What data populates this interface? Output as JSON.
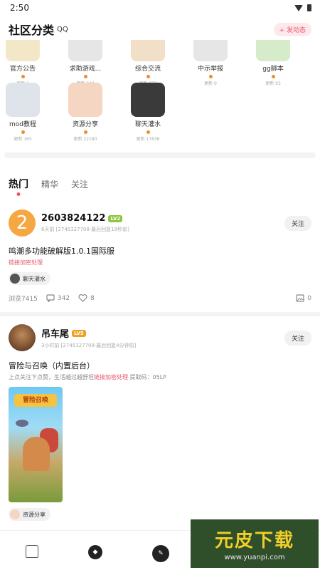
{
  "status_bar": {
    "time": "2:50"
  },
  "header": {
    "title": "社区分类",
    "title_icon": "QQ",
    "new_button": "+ 发动态"
  },
  "categories": [
    {
      "name": "官方公告",
      "count": "更新 6",
      "color": "#f2e8c8"
    },
    {
      "name": "求助游戏...",
      "count": "更新 240",
      "color": "#e6e6e6"
    },
    {
      "name": "综合交流",
      "count": "更新 872",
      "color": "#f2dfc8"
    },
    {
      "name": "中示举报",
      "count": "更新 0",
      "color": "#e6e6e6"
    },
    {
      "name": "gg脚本",
      "count": "更新 93",
      "color": "#d6ebc9"
    },
    {
      "name": "mod教程",
      "count": "更新 165",
      "color": "#dfe3ea"
    },
    {
      "name": "资源分享",
      "count": "更新 22180",
      "color": "#f4d6c2"
    },
    {
      "name": "聊天灌水",
      "count": "更新 17838",
      "color": "#3a3a3a"
    }
  ],
  "tabs": [
    "热门",
    "精华",
    "关注"
  ],
  "posts": [
    {
      "avatar_text": "2",
      "author": "2603824122",
      "level": "LV2",
      "level_color": "#8dc63f",
      "meta": "6天前 [2745327708·最后回复18秒前]",
      "follow": "关注",
      "title": "鸣潮多功能破解版1.0.1国际服",
      "sub_link": "链接加密处理",
      "tag": "聊天灌水",
      "views": "浏览7415",
      "comments": "342",
      "likes": "8",
      "images": "0"
    },
    {
      "author": "吊车尾",
      "level": "LV5",
      "level_color": "#f0a020",
      "meta": "3小时前 [2745327708·最后回复4分钟前]",
      "follow": "关注",
      "title": "冒险与召唤（内置后台）",
      "sub_prefix": "上点关注下点赞，生活越过越舒坦",
      "sub_link": "链接加密处理",
      "sub_suffix": " 提取码：05LP",
      "image_logo": "冒险召唤",
      "tag": "资源分享"
    }
  ],
  "watermark": {
    "title": "元皮下载",
    "url": "www.yuanpi.com"
  },
  "colors": {
    "accent": "#e8566a",
    "dot": "#f08c2a"
  }
}
